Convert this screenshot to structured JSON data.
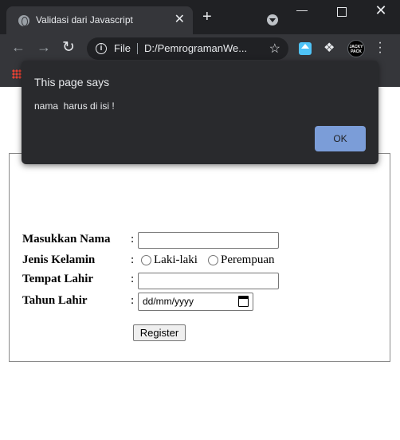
{
  "browser": {
    "tab_title": "Validasi dari Javascript",
    "tab_close": "✕",
    "new_tab": "+",
    "window_controls": {
      "minimize": "—",
      "close": "✕"
    },
    "address": {
      "scheme": "File",
      "url": "D:/PemrogramanWe..."
    },
    "icons": [
      "globe-icon",
      "back-arrow-icon",
      "forward-arrow-icon",
      "reload-icon",
      "info-icon",
      "star-icon",
      "home-extension-icon",
      "puzzle-icon",
      "profile-avatar-icon",
      "kebab-menu-icon",
      "apps-grid-icon"
    ],
    "avatar_text": "JACKY\nPACK"
  },
  "form": {
    "fields": [
      {
        "label": "Masukkan Nama",
        "colon": ":"
      },
      {
        "label": "Jenis Kelamin",
        "colon": ":",
        "options": [
          "Laki-laki",
          "Perempuan"
        ]
      },
      {
        "label": "Tempat Lahir",
        "colon": ":"
      },
      {
        "label": "Tahun Lahir",
        "colon": ":",
        "placeholder": "dd/mm/yyyy"
      }
    ],
    "submit_label": "Register"
  },
  "dialog": {
    "title": "This page says",
    "message": "nama  harus di isi !",
    "ok_label": "OK"
  },
  "colors": {
    "chrome_dark": "#202124",
    "chrome_toolbar": "#35363a",
    "dialog_bg": "#292a2d",
    "ok_button": "#7b9dd8"
  }
}
